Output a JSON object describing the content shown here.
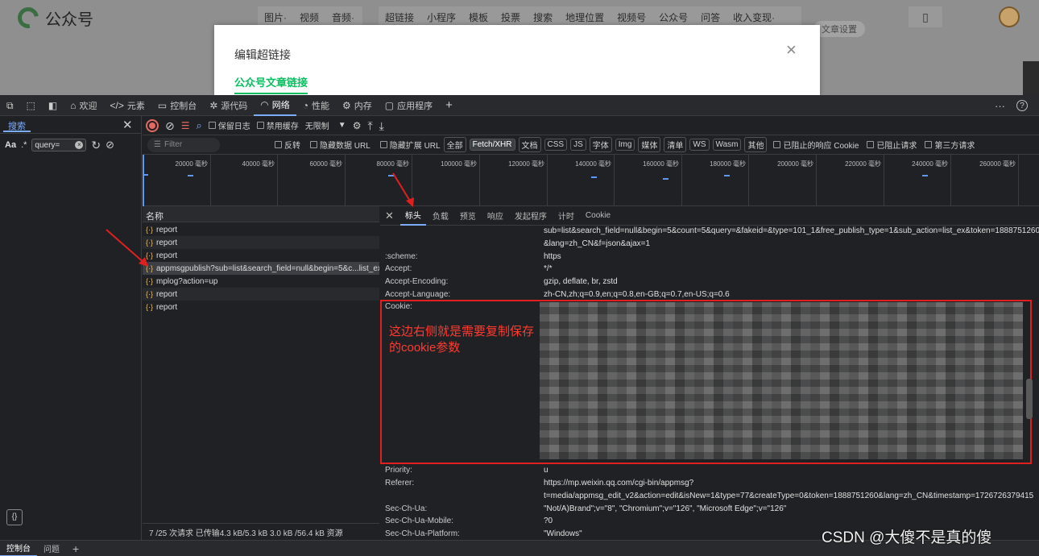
{
  "page": {
    "logo": "公众号",
    "toolbar1": [
      "图片·",
      "视频",
      "音频·"
    ],
    "toolbar2": [
      "超链接",
      "小程序",
      "模板",
      "投票",
      "搜索",
      "地理位置",
      "视频号",
      "公众号",
      "问答",
      "收入变现·"
    ],
    "settings": "文章设置"
  },
  "modal": {
    "title": "编辑超链接",
    "close": "×",
    "tab": "公众号文章链接"
  },
  "devtools": {
    "tabs": [
      "欢迎",
      "元素",
      "控制台",
      "源代码",
      "网络",
      "性能",
      "内存",
      "应用程序"
    ],
    "more": "···",
    "help": "?"
  },
  "search": {
    "tab": "搜索",
    "close": "✕",
    "aa": "Aa",
    "regex": ".*",
    "query": "query="
  },
  "network": {
    "preserve_log": "保留日志",
    "disable_cache": "禁用缓存",
    "throttle": "无限制",
    "filter_placeholder": "Filter",
    "invert": "反转",
    "hide_data_urls": "隐藏数据 URL",
    "hide_ext_urls": "隐藏扩展 URL",
    "types": [
      "全部",
      "Fetch/XHR",
      "文档",
      "CSS",
      "JS",
      "字体",
      "Img",
      "媒体",
      "清单",
      "WS",
      "Wasm",
      "其他"
    ],
    "blocked_cookies": "已阻止的响应 Cookie",
    "blocked_requests": "已阻止请求",
    "third_party": "第三方请求"
  },
  "timeline": {
    "ticks": [
      "20000 毫秒",
      "40000 毫秒",
      "60000 毫秒",
      "80000 毫秒",
      "100000 毫秒",
      "120000 毫秒",
      "140000 毫秒",
      "160000 毫秒",
      "180000 毫秒",
      "200000 毫秒",
      "220000 毫秒",
      "240000 毫秒",
      "260000 毫秒"
    ]
  },
  "requests": {
    "header": "名称",
    "items": [
      "report",
      "report",
      "report",
      "appmsgpublish?sub=list&search_field=null&begin=5&c...list_ex...",
      "mplog?action=up",
      "report",
      "report"
    ],
    "status": "7 /25 次请求  已传输4.3 kB/5.3 kB  3.0 kB /56.4 kB 资源"
  },
  "details": {
    "close": "✕",
    "tabs": [
      "标头",
      "负载",
      "预览",
      "响应",
      "发起程序",
      "计时",
      "Cookie"
    ],
    "path_line1": "sub=list&search_field=null&begin=5&count=5&query=&fakeid=&type=101_1&free_publish_type=1&sub_action=list_ex&token=1888751260",
    "path_line2": "&lang=zh_CN&f=json&ajax=1",
    "scheme_k": ":scheme:",
    "scheme_v": "https",
    "accept_k": "Accept:",
    "accept_v": "*/*",
    "enc_k": "Accept-Encoding:",
    "enc_v": "gzip, deflate, br, zstd",
    "lang_k": "Accept-Language:",
    "lang_v": "zh-CN,zh;q=0.9,en;q=0.8,en-GB;q=0.7,en-US;q=0.6",
    "cookie_k": "Cookie:",
    "priority_k": "Priority:",
    "priority_v": "u",
    "referer_k": "Referer:",
    "referer_v1": "https://mp.weixin.qq.com/cgi-bin/appmsg?",
    "referer_v2": "t=media/appmsg_edit_v2&action=edit&isNew=1&type=77&createType=0&token=1888751260&lang=zh_CN&timestamp=1726726379415",
    "ua_k": "Sec-Ch-Ua:",
    "ua_v": "\"Not/A)Brand\";v=\"8\", \"Chromium\";v=\"126\", \"Microsoft Edge\";v=\"126\"",
    "mobile_k": "Sec-Ch-Ua-Mobile:",
    "mobile_v": "?0",
    "platform_k": "Sec-Ch-Ua-Platform:",
    "platform_v": "\"Windows\""
  },
  "annotation": "这边右侧就是需要复制保存的cookie参数",
  "drawer": {
    "tabs": [
      "控制台",
      "问题"
    ],
    "add": "+"
  },
  "watermark": "CSDN @大傻不是真的傻",
  "colors": {
    "accent": "#07c160",
    "highlight": "#e02020",
    "devtools_blue": "#7cacf8"
  }
}
